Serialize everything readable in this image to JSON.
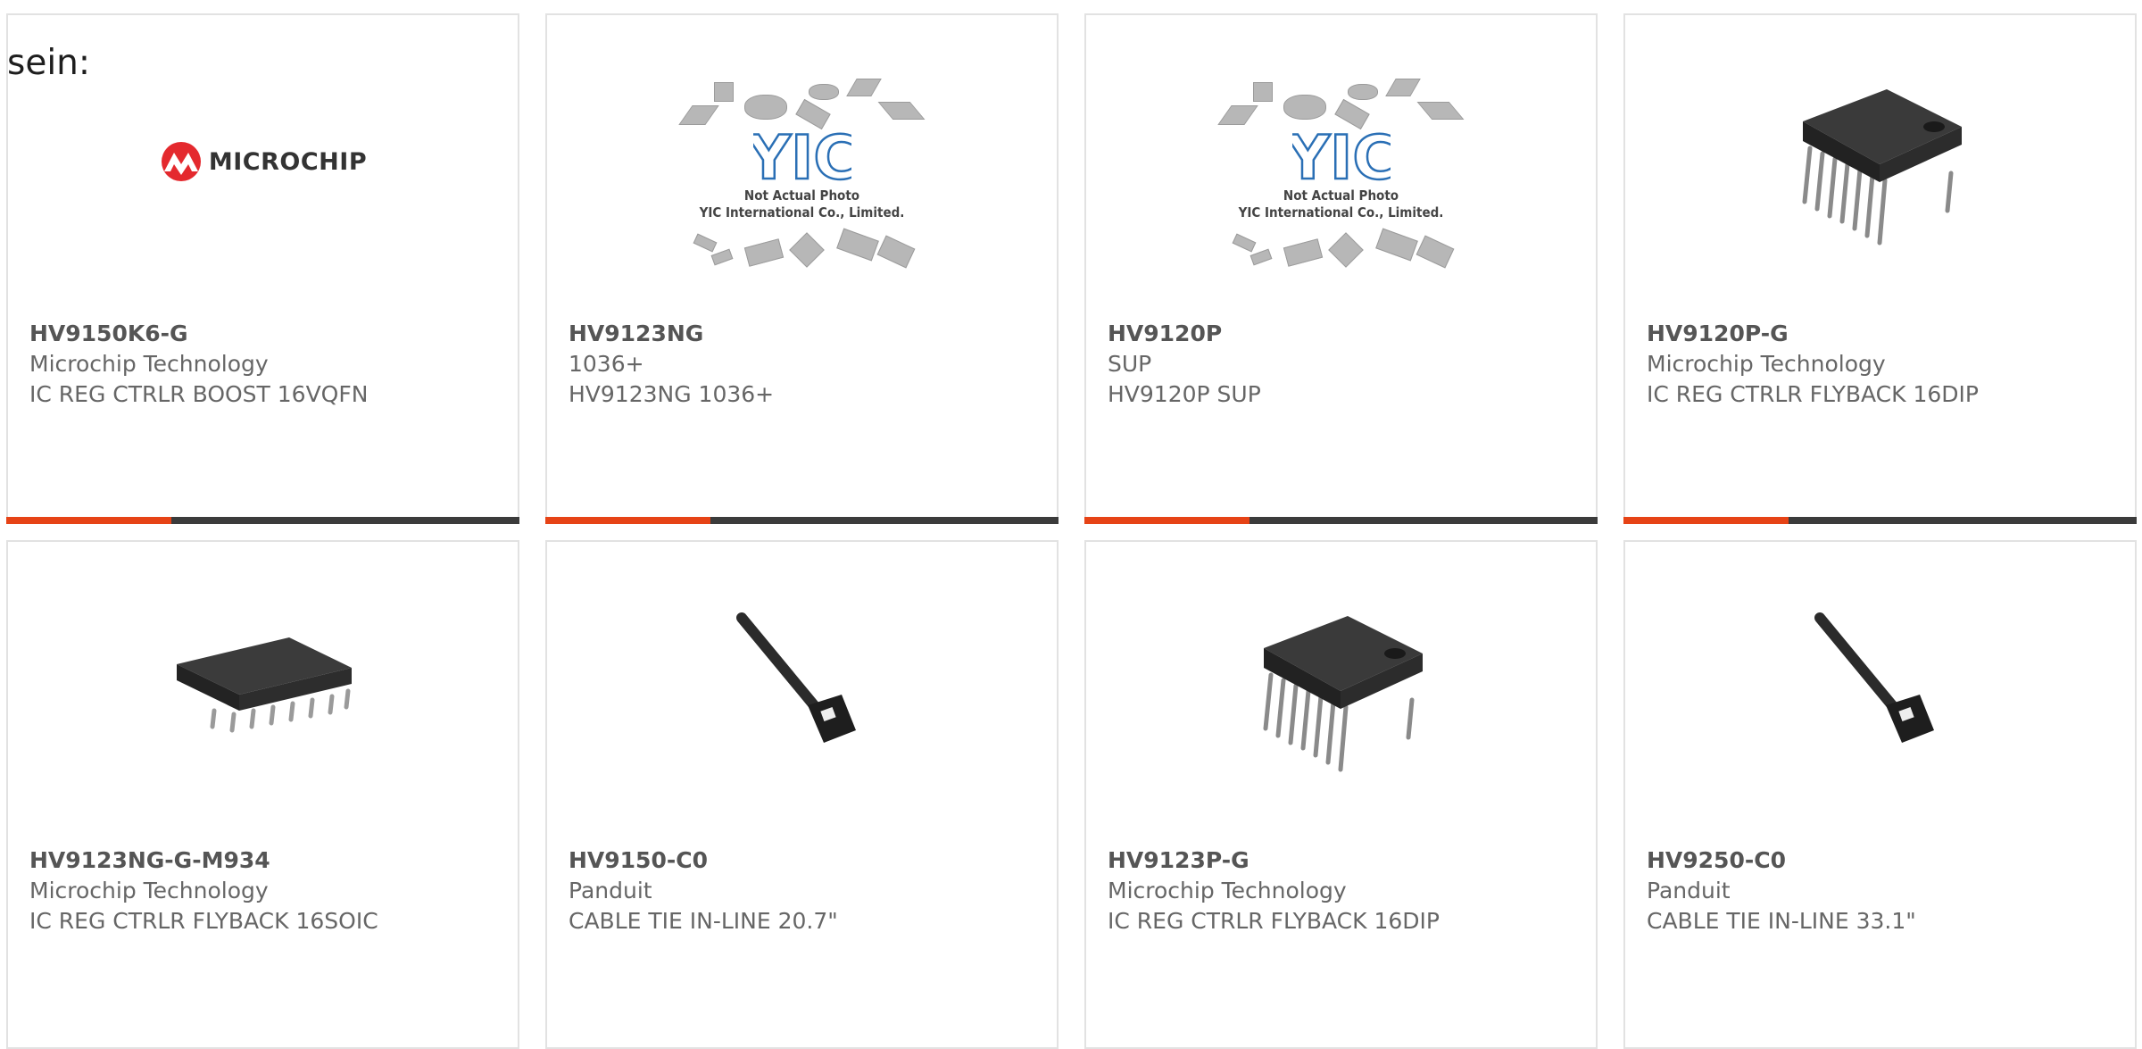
{
  "lead_text": "sein:",
  "brand_logo_text": "MICROCHIP",
  "placeholder": {
    "logo_text": "YIC",
    "line1": "Not Actual Photo",
    "line2": "YIC International Co., Limited."
  },
  "accent_color": "#e64316",
  "bar_color": "#3b3b3b",
  "products": [
    {
      "part": "HV9150K6-G",
      "maker": "Microchip Technology",
      "desc": "IC REG CTRLR BOOST 16VQFN",
      "image": "microchip-logo"
    },
    {
      "part": "HV9123NG",
      "maker": "1036+",
      "desc": "HV9123NG 1036+",
      "image": "yic-placeholder"
    },
    {
      "part": "HV9120P",
      "maker": "SUP",
      "desc": "HV9120P SUP",
      "image": "yic-placeholder"
    },
    {
      "part": "HV9120P-G",
      "maker": "Microchip Technology",
      "desc": "IC REG CTRLR FLYBACK 16DIP",
      "image": "dip16-chip"
    },
    {
      "part": "HV9123NG-G-M934",
      "maker": "Microchip Technology",
      "desc": "IC REG CTRLR FLYBACK 16SOIC",
      "image": "soic16-chip"
    },
    {
      "part": "HV9150-C0",
      "maker": "Panduit",
      "desc": "CABLE TIE IN-LINE 20.7\"",
      "image": "cable-tie"
    },
    {
      "part": "HV9123P-G",
      "maker": "Microchip Technology",
      "desc": "IC REG CTRLR FLYBACK 16DIP",
      "image": "dip16-chip"
    },
    {
      "part": "HV9250-C0",
      "maker": "Panduit",
      "desc": "CABLE TIE IN-LINE 33.1\"",
      "image": "cable-tie"
    }
  ]
}
